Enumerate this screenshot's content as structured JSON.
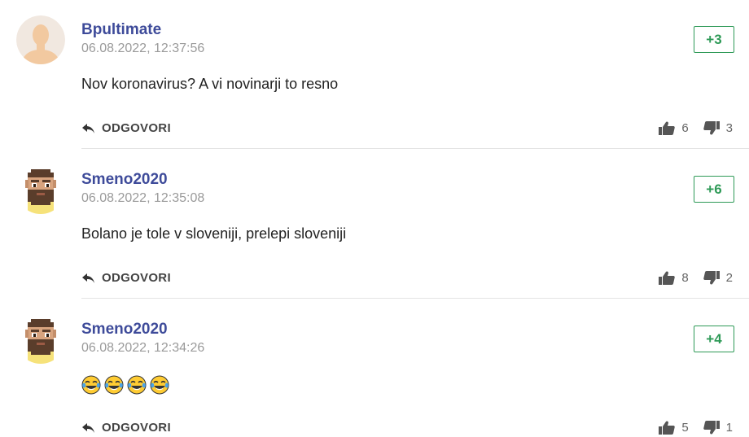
{
  "colors": {
    "author": "#3e4b9a",
    "score": "#2e9a57",
    "timestamp": "#9a9a9a"
  },
  "comments": [
    {
      "author": "Bpultimate",
      "timestamp": "06.08.2022, 12:37:56",
      "score": "+3",
      "text": "Nov koronavirus? A vi novinarji to resno",
      "emojis": [],
      "reply_label": "ODGOVORI",
      "likes": "6",
      "dislikes": "3",
      "avatar": "default-person-avatar"
    },
    {
      "author": "Smeno2020",
      "timestamp": "06.08.2022, 12:35:08",
      "score": "+6",
      "text": "Bolano je tole v sloveniji, prelepi sloveniji",
      "emojis": [],
      "reply_label": "ODGOVORI",
      "likes": "8",
      "dislikes": "2",
      "avatar": "pixel-bearded-man-avatar"
    },
    {
      "author": "Smeno2020",
      "timestamp": "06.08.2022, 12:34:26",
      "score": "+4",
      "text": "",
      "emojis": [
        "😂",
        "😂",
        "😂",
        "😂"
      ],
      "reply_label": "ODGOVORI",
      "likes": "5",
      "dislikes": "1",
      "avatar": "pixel-bearded-man-avatar"
    }
  ]
}
